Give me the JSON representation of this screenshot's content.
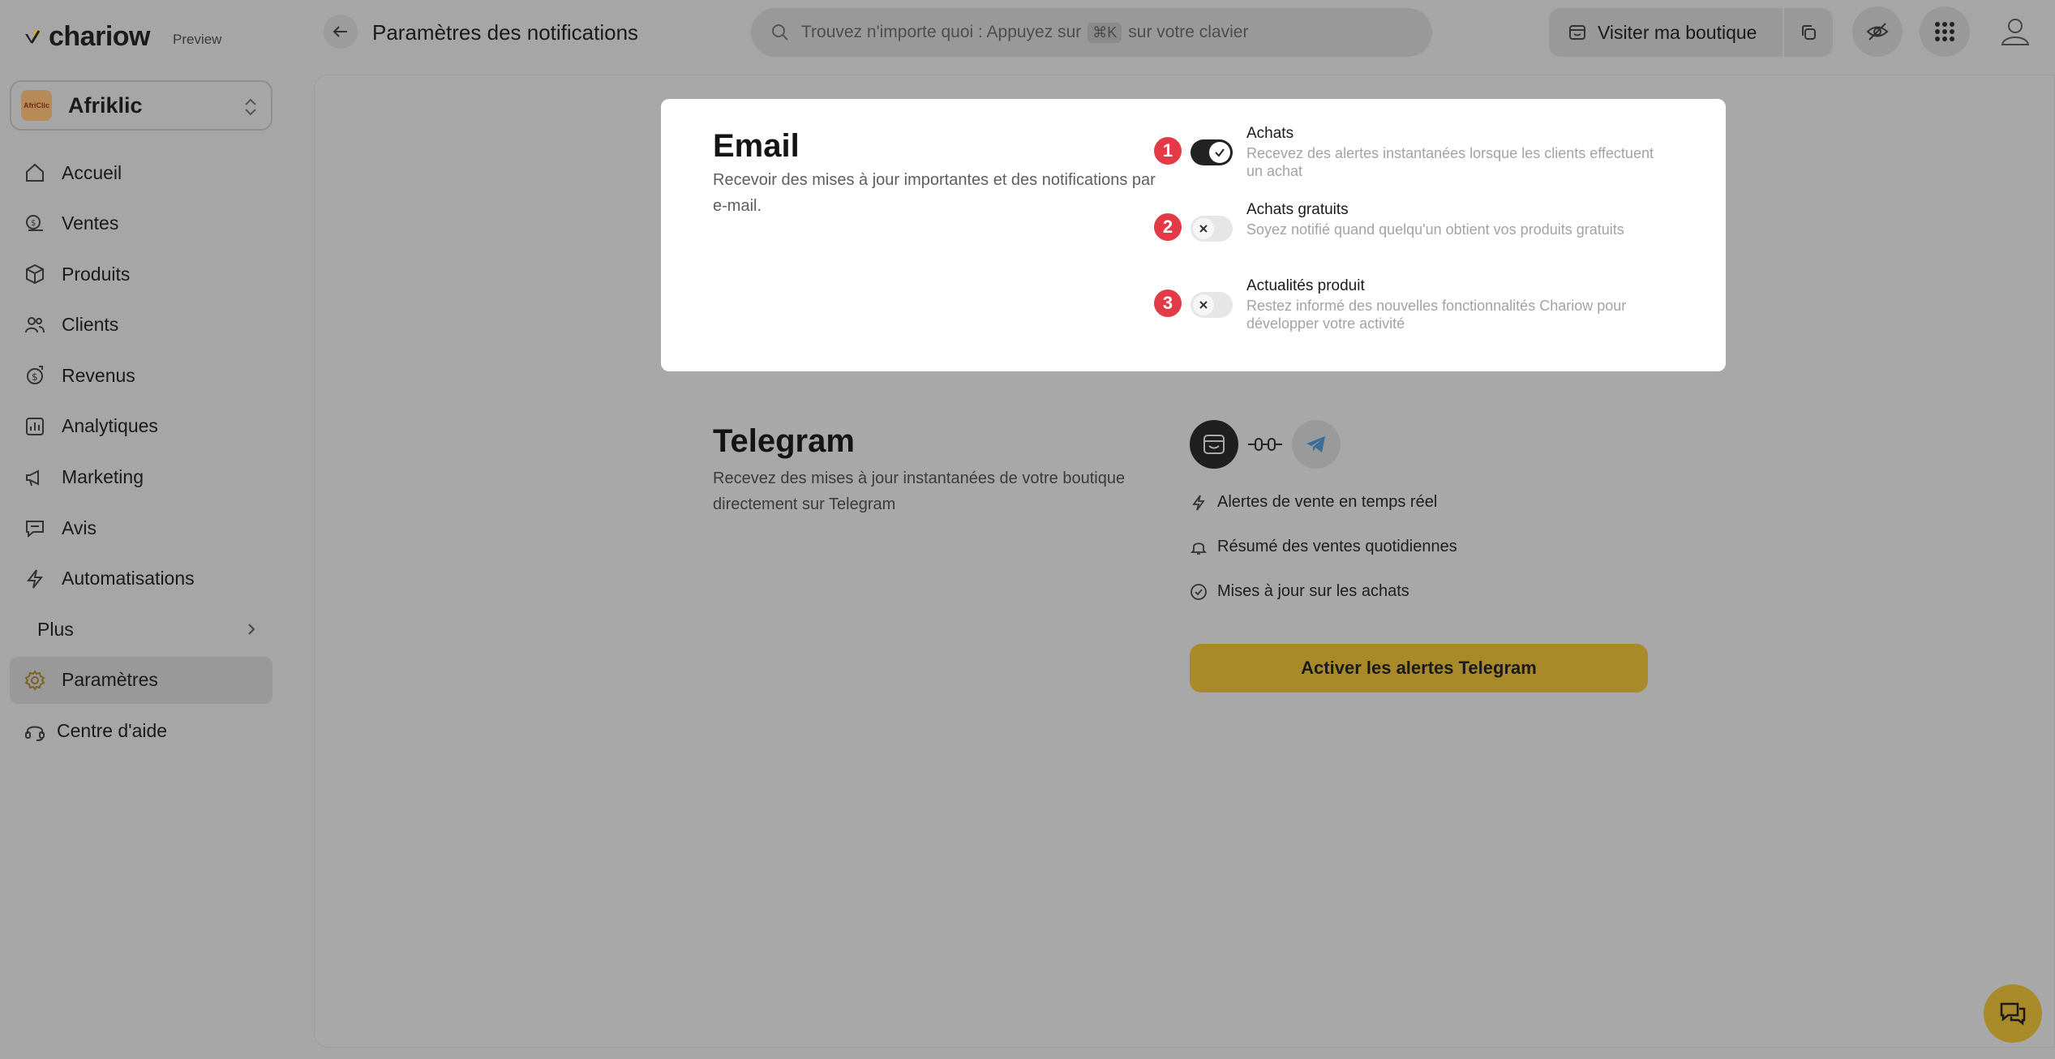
{
  "brand": {
    "name": "chariow",
    "badge": "Preview"
  },
  "store": {
    "name": "Afriklic",
    "avatar_text": "AfriClic"
  },
  "sidebar": {
    "items": [
      {
        "label": "Accueil",
        "icon": "home-icon"
      },
      {
        "label": "Ventes",
        "icon": "money-icon"
      },
      {
        "label": "Produits",
        "icon": "box-icon"
      },
      {
        "label": "Clients",
        "icon": "users-icon"
      },
      {
        "label": "Revenus",
        "icon": "revenue-icon"
      },
      {
        "label": "Analytiques",
        "icon": "chart-icon"
      },
      {
        "label": "Marketing",
        "icon": "megaphone-icon"
      },
      {
        "label": "Avis",
        "icon": "message-icon"
      },
      {
        "label": "Automatisations",
        "icon": "bolt-icon"
      },
      {
        "label": "Plus",
        "icon": "more-icon"
      },
      {
        "label": "Paramètres",
        "icon": "gear-icon",
        "active": true
      }
    ],
    "help": "Centre d'aide"
  },
  "header": {
    "title": "Paramètres des notifications",
    "search_prefix": "Trouvez n'importe quoi : Appuyez sur",
    "search_key": "⌘K",
    "search_suffix": "sur votre clavier",
    "visit_label": "Visiter ma boutique"
  },
  "email": {
    "title": "Email",
    "description": "Recevoir des mises à jour importantes et des notifications par e-mail.",
    "options": [
      {
        "badge": "1",
        "title": "Achats",
        "description": "Recevez des alertes instantanées lorsque les clients effectuent un achat",
        "enabled": true
      },
      {
        "badge": "2",
        "title": "Achats gratuits",
        "description": "Soyez notifié quand quelqu'un obtient vos produits gratuits",
        "enabled": false
      },
      {
        "badge": "3",
        "title": "Actualités produit",
        "description": "Restez informé des nouvelles fonctionnalités Chariow pour développer votre activité",
        "enabled": false
      }
    ]
  },
  "telegram": {
    "title": "Telegram",
    "description": "Recevez des mises à jour instantanées de votre boutique directement sur Telegram",
    "features": [
      {
        "label": "Alertes de vente en temps réel",
        "icon": "bolt-icon"
      },
      {
        "label": "Résumé des ventes quotidiennes",
        "icon": "bell-icon"
      },
      {
        "label": "Mises à jour sur les achats",
        "icon": "check-circle-icon"
      }
    ],
    "button": "Activer les alertes Telegram"
  },
  "colors": {
    "accent": "#a98a28",
    "badge": "#e23a46",
    "overlay": "#a6a6a6"
  }
}
